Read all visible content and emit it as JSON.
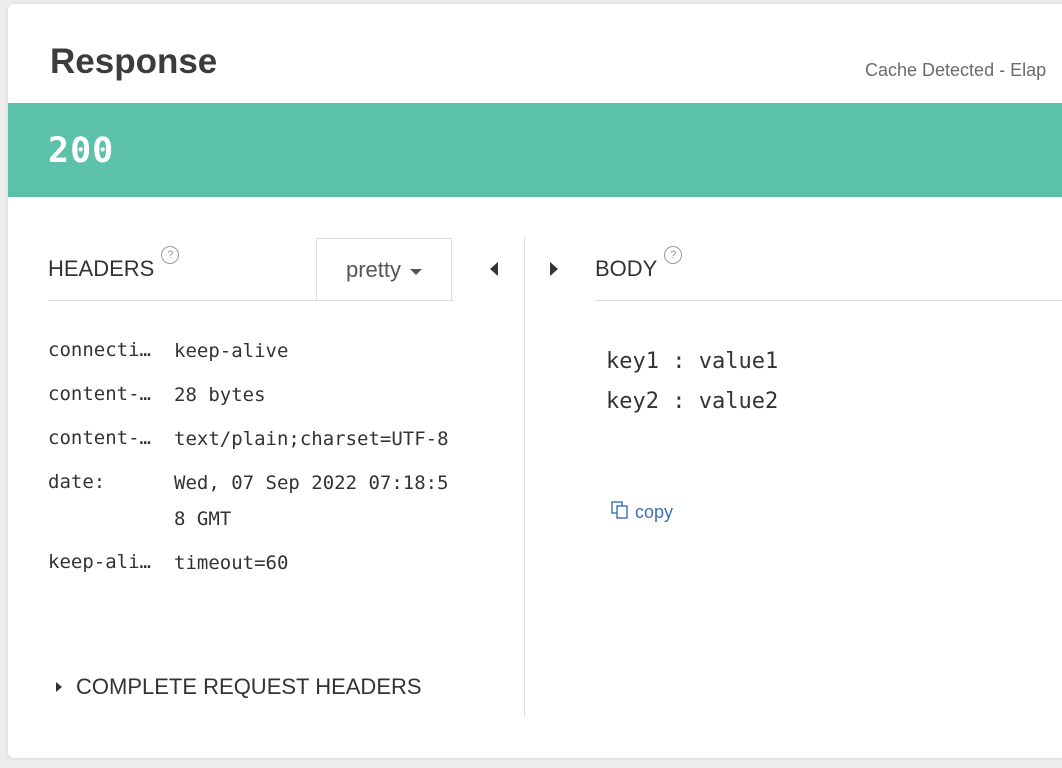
{
  "response": {
    "title": "Response",
    "cache_note": "Cache Detected - Elap"
  },
  "status": {
    "code": "200"
  },
  "headers_panel": {
    "title": "HEADERS",
    "format_select": "pretty",
    "rows": [
      {
        "key": "connecti…",
        "value": "keep-alive"
      },
      {
        "key": "content-…",
        "value": "28 bytes"
      },
      {
        "key": "content-…",
        "value": "text/plain;charset=UTF-8"
      },
      {
        "key": "date:",
        "value": "Wed, 07 Sep 2022 07:18:58 GMT"
      },
      {
        "key": "keep-ali…",
        "value": "timeout=60"
      }
    ],
    "complete_request_headers": "COMPLETE REQUEST HEADERS"
  },
  "body_panel": {
    "title": "BODY",
    "lines": [
      "key1 : value1",
      "key2 : value2"
    ],
    "copy_label": "copy"
  },
  "icons": {
    "help": "question-circle-icon",
    "copy": "copy-icon"
  },
  "colors": {
    "status_bar": "#5bc1a8",
    "link": "#3d6fb3"
  }
}
